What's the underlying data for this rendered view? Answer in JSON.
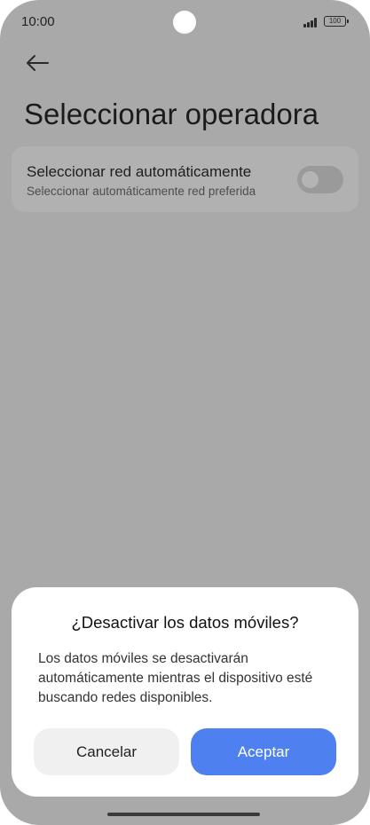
{
  "status_bar": {
    "time": "10:00",
    "battery": "100"
  },
  "header": {
    "title": "Seleccionar operadora"
  },
  "setting": {
    "title": "Seleccionar red automáticamente",
    "subtitle": "Seleccionar automáticamente red preferida",
    "toggle_on": false
  },
  "dialog": {
    "title": "¿Desactivar los datos móviles?",
    "body": "Los datos móviles se desactivarán automáticamente mientras el dispositivo esté buscando redes disponibles.",
    "cancel_label": "Cancelar",
    "accept_label": "Aceptar"
  },
  "colors": {
    "accent": "#4e80f0",
    "scrim": "#a9a9a9",
    "dialog_bg": "#ffffff"
  },
  "icons": {
    "back": "arrow-left-icon",
    "signal": "signal-icon",
    "battery": "battery-icon"
  }
}
